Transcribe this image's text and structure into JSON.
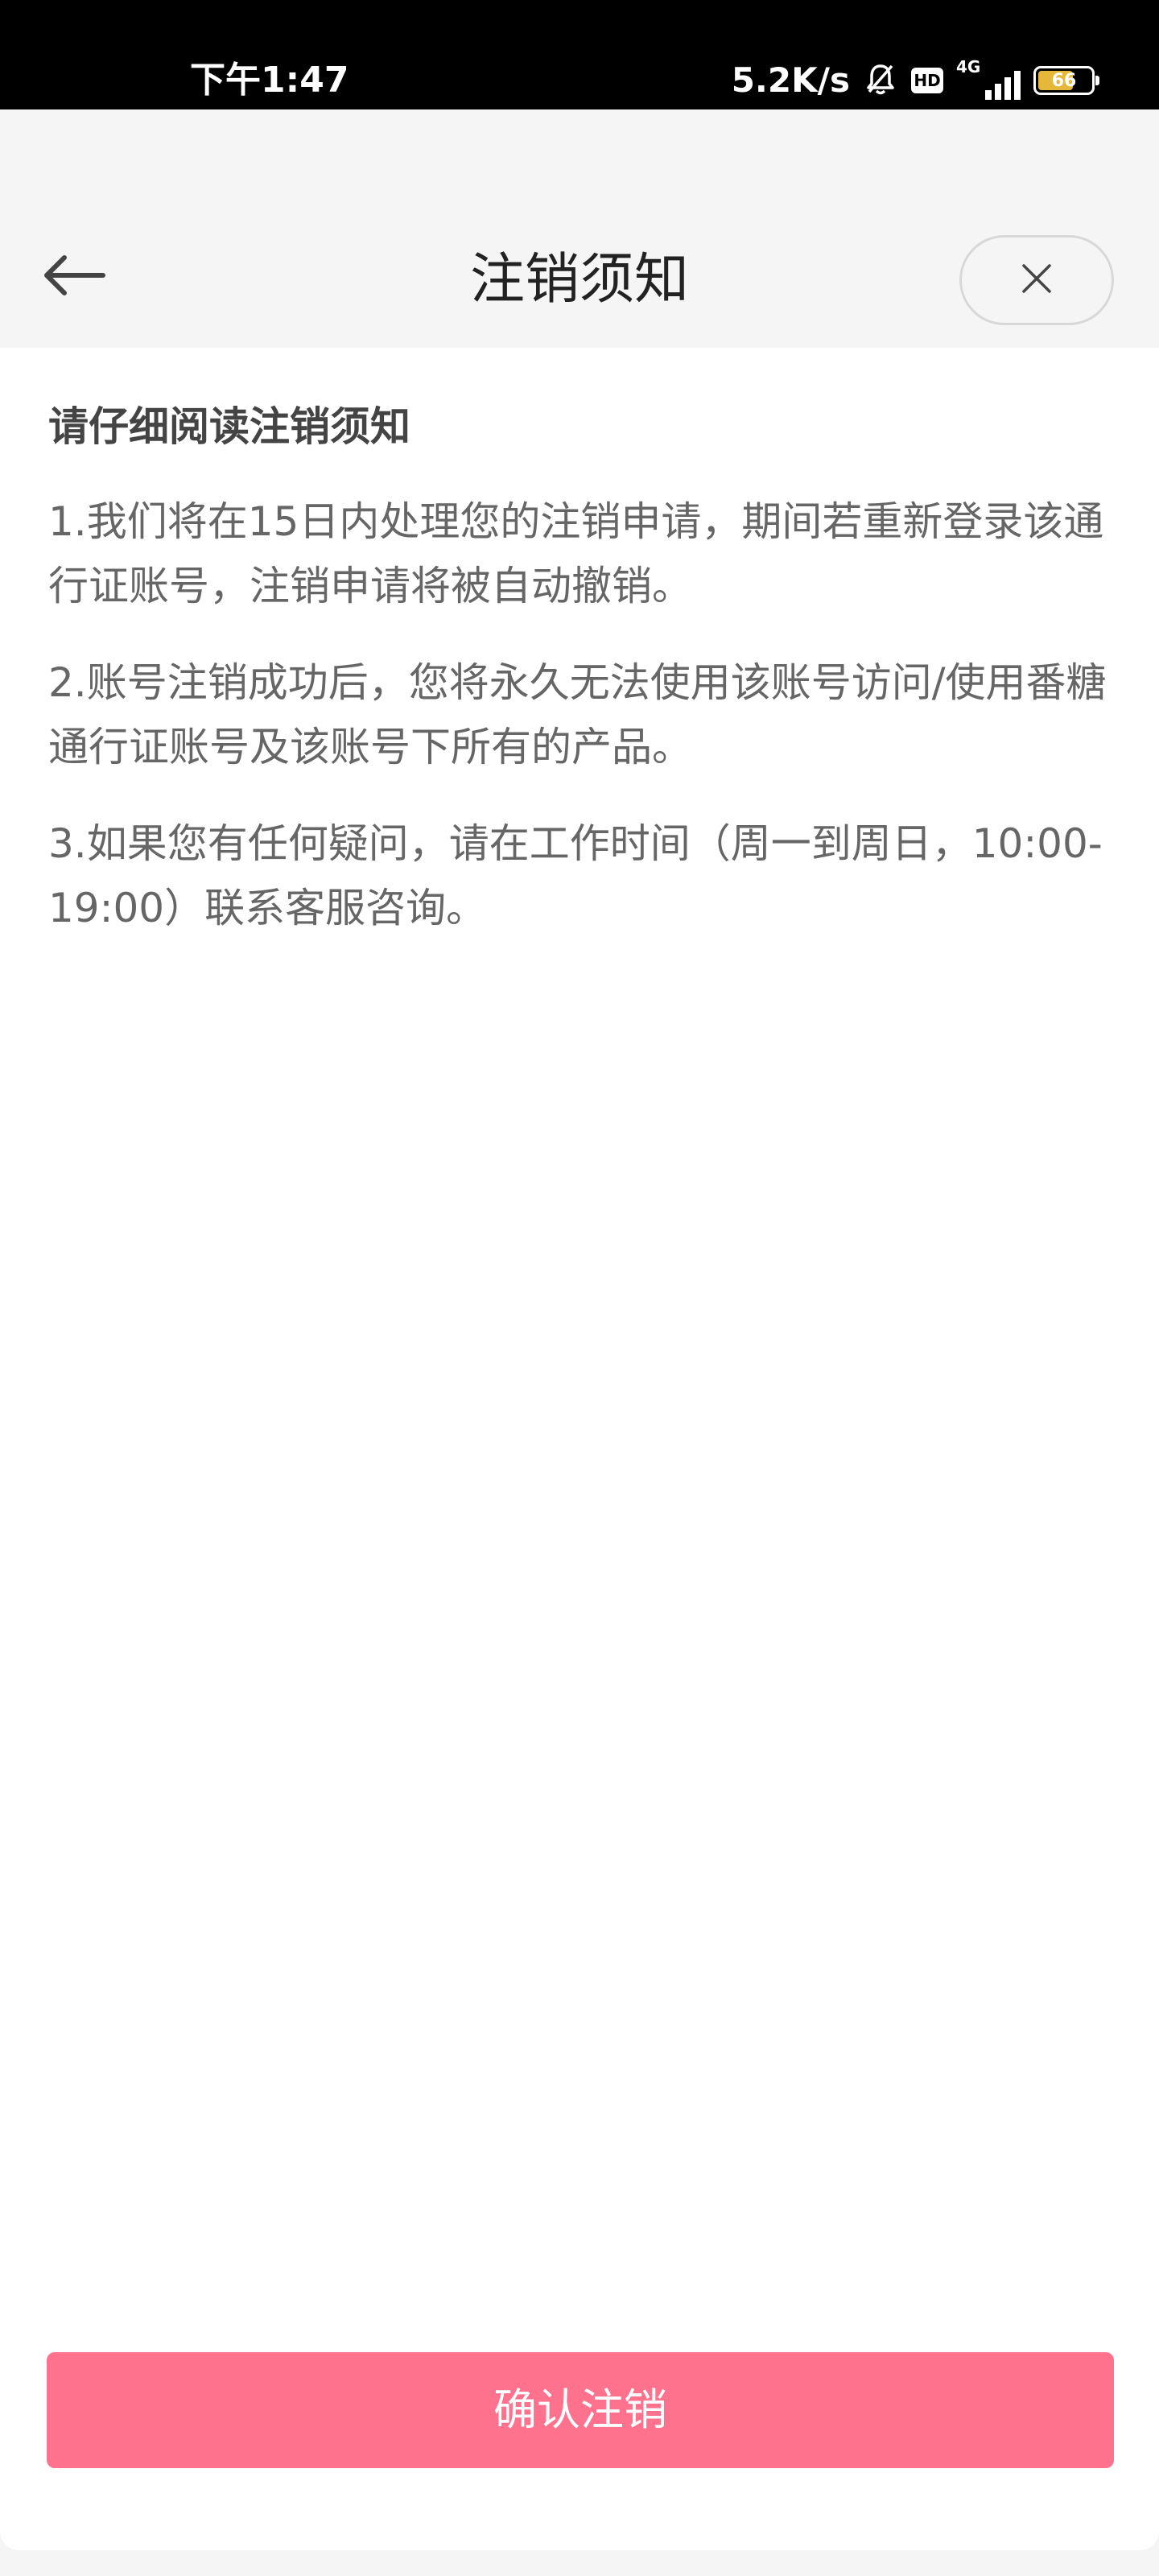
{
  "status_bar": {
    "time": "下午1:47",
    "net_speed": "5.2K/s",
    "hd_badge": "HD",
    "network_type": "4G",
    "battery_level": "66",
    "icons": [
      "mute-bell-icon",
      "hd-icon",
      "signal-icon",
      "battery-icon"
    ]
  },
  "header": {
    "title": "注销须知",
    "back_icon": "arrow-left-icon",
    "close_icon": "close-icon"
  },
  "notice": {
    "heading": "请仔细阅读注销须知",
    "items": [
      "1.我们将在15日内处理您的注销申请，期间若重新登录该通行证账号，注销申请将被自动撤销。",
      "2.账号注销成功后，您将永久无法使用该账号访问/使用番糖通行证账号及该账号下所有的产品。",
      "3.如果您有任何疑问，请在工作时间（周一到周日，10:00-19:00）联系客服咨询。"
    ]
  },
  "footer": {
    "confirm_label": "确认注销"
  },
  "colors": {
    "accent": "#ff728d",
    "page_background": "#f5f5f5",
    "content_background": "#ffffff",
    "battery_fill": "#e6b83a"
  }
}
